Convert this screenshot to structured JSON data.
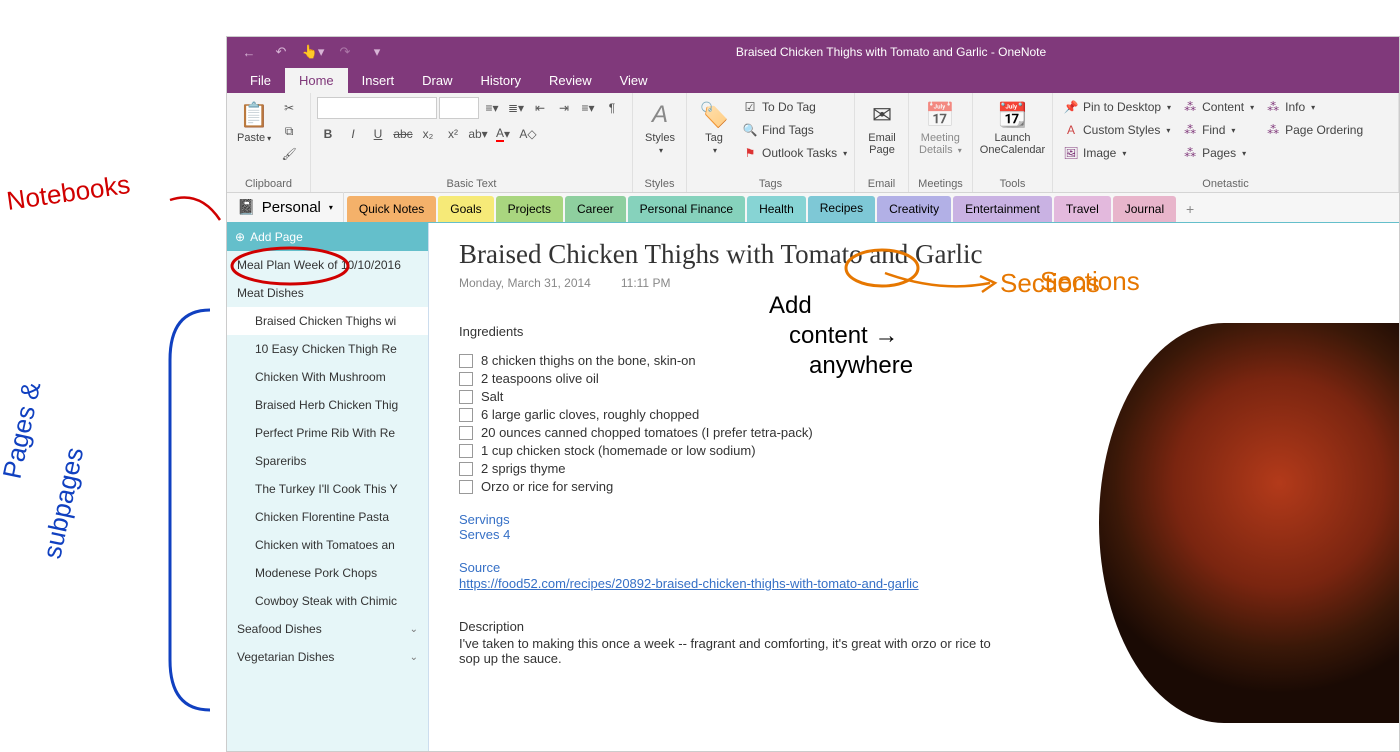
{
  "title": "Braised Chicken Thighs with Tomato and Garlic  -  OneNote",
  "menus": {
    "file": "File",
    "home": "Home",
    "insert": "Insert",
    "draw": "Draw",
    "history": "History",
    "review": "Review",
    "view": "View"
  },
  "ribbon": {
    "clipboard": {
      "paste": "Paste",
      "label": "Clipboard"
    },
    "basictext": {
      "label": "Basic Text"
    },
    "styles": {
      "label": "Styles",
      "btn": "Styles"
    },
    "tags": {
      "label": "Tags",
      "tag": "Tag",
      "todo": "To Do Tag",
      "find": "Find Tags",
      "outlook": "Outlook Tasks"
    },
    "email": {
      "label": "Email",
      "btn": "Email\nPage"
    },
    "meetings": {
      "label": "Meetings",
      "btn": "Meeting\nDetails"
    },
    "tools": {
      "label": "Tools",
      "btn": "Launch\nOneCalendar"
    },
    "onetastic": {
      "label": "Onetastic",
      "pin": "Pin to Desktop",
      "cstyles": "Custom Styles",
      "image": "Image",
      "find": "Find",
      "content": "Content",
      "info": "Info",
      "pageorder": "Page Ordering",
      "pages": "Pages"
    }
  },
  "notebook": "Personal",
  "sections": [
    {
      "label": "Quick Notes",
      "bg": "#F4B16A"
    },
    {
      "label": "Goals",
      "bg": "#F6EA78"
    },
    {
      "label": "Projects",
      "bg": "#A9D67F"
    },
    {
      "label": "Career",
      "bg": "#8ECF9F"
    },
    {
      "label": "Personal Finance",
      "bg": "#86D2BC"
    },
    {
      "label": "Health",
      "bg": "#87D4D4"
    },
    {
      "label": "Recipes",
      "bg": "#7EC8D6",
      "active": true
    },
    {
      "label": "Creativity",
      "bg": "#B2B0E6"
    },
    {
      "label": "Entertainment",
      "bg": "#C9B2E3"
    },
    {
      "label": "Travel",
      "bg": "#E3B9DD"
    },
    {
      "label": "Journal",
      "bg": "#E8B5CB"
    }
  ],
  "addpage": "Add Page",
  "pages": [
    {
      "label": "Meal Plan Week of 10/10/2016"
    },
    {
      "label": "Meat Dishes",
      "group": true
    },
    {
      "label": "Braised Chicken Thighs wi",
      "sub": true,
      "selected": true
    },
    {
      "label": "10 Easy Chicken Thigh Re",
      "sub": true
    },
    {
      "label": "Chicken With Mushroom",
      "sub": true
    },
    {
      "label": "Braised Herb Chicken Thig",
      "sub": true
    },
    {
      "label": "Perfect Prime Rib With Re",
      "sub": true
    },
    {
      "label": "Spareribs",
      "sub": true
    },
    {
      "label": "The Turkey I'll Cook This Y",
      "sub": true
    },
    {
      "label": "Chicken Florentine Pasta",
      "sub": true
    },
    {
      "label": "Chicken with Tomatoes an",
      "sub": true
    },
    {
      "label": "Modenese Pork Chops",
      "sub": true
    },
    {
      "label": "Cowboy Steak with Chimic",
      "sub": true
    },
    {
      "label": "Seafood Dishes",
      "group": true,
      "chev": true
    },
    {
      "label": "Vegetarian Dishes",
      "group": true,
      "chev": true
    }
  ],
  "page": {
    "title": "Braised Chicken Thighs with Tomato and Garlic",
    "date": "Monday, March 31, 2014",
    "time": "11:11 PM",
    "ing_h": "Ingredients",
    "ingredients": [
      "8 chicken thighs on the bone, skin-on",
      "2 teaspoons olive oil",
      "Salt",
      "6 large garlic cloves, roughly chopped",
      "20 ounces canned chopped tomatoes (I prefer tetra-pack)",
      "1 cup chicken stock (homemade or low sodium)",
      "2 sprigs thyme",
      "Orzo or rice for serving"
    ],
    "serv_h": "Servings",
    "serv": "Serves 4",
    "src_h": "Source",
    "src_url": "https://food52.com/recipes/20892-braised-chicken-thighs-with-tomato-and-garlic",
    "desc_h": "Description",
    "desc": "I've taken to making this once a week -- fragrant and comforting, it's great with orzo or rice to sop up the sauce."
  },
  "annotations": {
    "notebooks": "Notebooks",
    "pages": "Pages & subpages",
    "sections": "Sections",
    "addcontent": "Add content anywhere"
  }
}
